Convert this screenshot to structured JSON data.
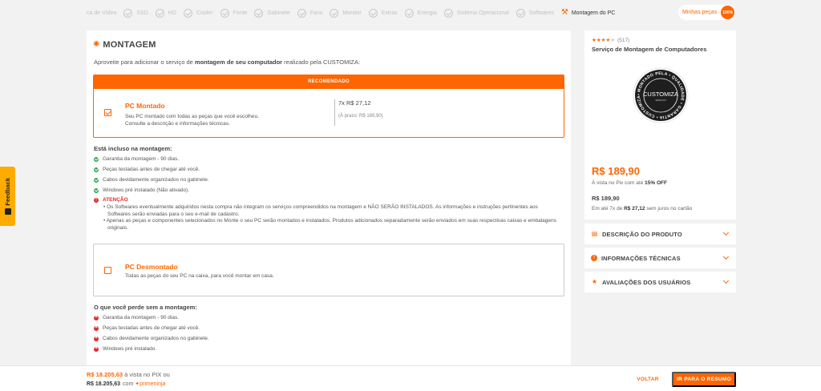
{
  "nav": {
    "steps": [
      {
        "label": "ca de Vídeo"
      },
      {
        "label": "SSD"
      },
      {
        "label": "HD"
      },
      {
        "label": "Cooler"
      },
      {
        "label": "Fonte"
      },
      {
        "label": "Gabinete"
      },
      {
        "label": "Fans"
      },
      {
        "label": "Monitor"
      },
      {
        "label": "Extras"
      },
      {
        "label": "Energia"
      },
      {
        "label": "Sistema Operacional"
      },
      {
        "label": "Softwares"
      }
    ],
    "active_step": "Montagem do PC",
    "my_parts_label": "Minhas peças",
    "progress_label": "100%",
    "progress": 100
  },
  "section": {
    "title": "MONTAGEM",
    "intro_pre": "Aproveite para adicionar o serviço de ",
    "intro_bold": "montagem de seu computador",
    "intro_post": " realizado pela CUSTOMIZA:"
  },
  "option_assembled": {
    "badge": "RECOMENDADO",
    "title": "PC Montado",
    "desc_line1": "Seu PC montado com todas as peças que você escolheu.",
    "desc_line2": "Consulte a descrição e informações técnicas.",
    "installments": "7x R$ 27,12",
    "cash": "(À prazo: R$ 189,90)",
    "checked": true
  },
  "included": {
    "heading": "Está incluso na montagem:",
    "items": [
      "Garantia da montagem - 90 dias.",
      "Peças testadas antes de chegar até você.",
      "Cabos devidamente organizados no gabinete.",
      "Windows pré instalado (Não ativado)."
    ],
    "warning_label": "ATENÇÃO",
    "warning_bullets": [
      "• Os Softwares eventualmente adquiridos nesta compra não integram os serviços compreendidos na montagem e NÃO SERÃO INSTALADOS. As informações e instruções pertinentes aos Softwares serão enviadas para o seu e-mail de cadastro.",
      "• Apenas as peças e componentes selecionados no Monte o seu PC serão montados e instalados. Produtos adicionados separadamente serão enviados em suas respectivas caixas e embalagens originais."
    ]
  },
  "option_disassembled": {
    "title": "PC Desmontado",
    "desc": "Todas as peças do seu PC na caixa, para você montar em casa.",
    "checked": false
  },
  "lost": {
    "heading": "O que você perde sem a montagem:",
    "items": [
      "Garantia da montagem - 90 dias.",
      "Peças testadas antes de chegar até você.",
      "Cabos devidamente organizados no gabinete.",
      "Windows pré instalado."
    ]
  },
  "product": {
    "rating": 4,
    "reviews": "(517)",
    "name": "Serviço de Montagem de Computadores",
    "seal_main": "CUSTOMIZA",
    "seal_sub": "SERVIÇOS",
    "seal_ring": "• MONTADO PELA • QUALIDADE • GARANTIA • CUSTOMIZA •",
    "price_pix": "R$ 189,90",
    "pix_pre": "À vista no Pix com até ",
    "pix_off": "15% OFF",
    "price": "R$ 189,90",
    "inst_pre": "Em até 7x de ",
    "inst_val": "R$ 27,12",
    "inst_post": " sem juros no cartão"
  },
  "accordions": [
    {
      "label": "DESCRIÇÃO DO PRODUTO",
      "icon": "document-icon"
    },
    {
      "label": "INFORMAÇÕES TÉCNICAS",
      "icon": "info-icon"
    },
    {
      "label": "AVALIAÇÕES DOS USUÁRIOS",
      "icon": "star-icon"
    }
  ],
  "feedback_label": "Feedback",
  "footer": {
    "total_pix": "R$ 18.205,63",
    "total_pix_suffix": " à vista no PIX ou",
    "total_ninja": "R$ 18.205,63",
    "ninja_pre": "com",
    "ninja_brand": "primeninja",
    "back_label": "VOLTAR",
    "summary_label": "IR PARA O RESUMO"
  },
  "colors": {
    "accent": "#ff6500",
    "ok": "#2ea84a",
    "error": "#e22a2a",
    "feedback": "#ffab00"
  }
}
